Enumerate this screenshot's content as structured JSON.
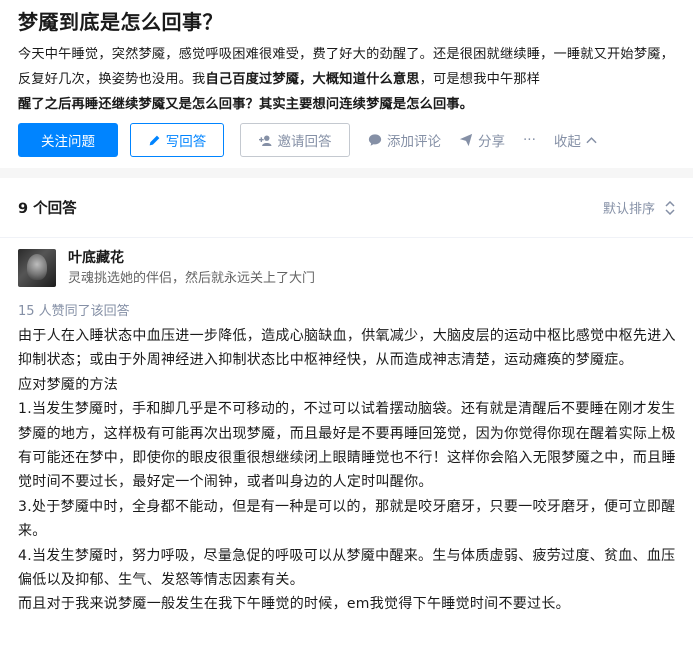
{
  "question": {
    "title": "梦魇到底是怎么回事？",
    "desc_part1": "今天中午睡觉，突然梦魇，感觉呼吸困难很难受，费了好大的劲醒了。还是很困就继续睡，一睡就又开始梦魇，反复好几次，换姿势也没用。我",
    "desc_bold1": "自己百度过梦魇，大概知道什么意思",
    "desc_part2": "，可是想我中午那样",
    "desc_bold2": "醒了之后再睡还继续梦魇又是怎么回事？其实主要想问连续梦魇是怎么回事。"
  },
  "actions": {
    "follow": "关注问题",
    "write": "写回答",
    "invite": "邀请回答",
    "comment": "添加评论",
    "share": "分享",
    "more": "···",
    "collapse": "收起"
  },
  "answers": {
    "count": "9 个回答",
    "sort": "默认排序"
  },
  "answer": {
    "author_name": "叶底藏花",
    "author_bio": "灵魂挑选她的伴侣，然后就永远关上了大门",
    "votes": "15 人赞同了该回答",
    "paragraphs": [
      "由于人在入睡状态中血压进一步降低，造成心脑缺血，供氧减少，大脑皮层的运动中枢比感觉中枢先进入抑制状态；或由于外周神经进入抑制状态比中枢神经快，从而造成神志清楚，运动瘫痪的梦魇症。",
      "应对梦魇的方法",
      "1.当发生梦魇时，手和脚几乎是不可移动的，不过可以试着摆动脑袋。还有就是清醒后不要睡在刚才发生梦魇的地方，这样极有可能再次出现梦魇，而且最好是不要再睡回笼觉，因为你觉得你现在醒着实际上极有可能还在梦中，即使你的眼皮很重很想继续闭上眼睛睡觉也不行！这样你会陷入无限梦魇之中，而且睡觉时间不要过长，最好定一个闹钟，或者叫身边的人定时叫醒你。",
      "3.处于梦魇中时，全身都不能动，但是有一种是可以的，那就是咬牙磨牙，只要一咬牙磨牙，便可立即醒来。",
      "4.当发生梦魇时，努力呼吸，尽量急促的呼吸可以从梦魇中醒来。生与体质虚弱、疲劳过度、贫血、血压偏低以及抑郁、生气、发怒等情志因素有关。",
      "而且对于我来说梦魇一般发生在我下午睡觉的时候，em我觉得下午睡觉时间不要过长。"
    ]
  },
  "colors": {
    "primary": "#0084ff",
    "muted": "#8590a6"
  },
  "icons": [
    "pen-icon",
    "invite-user-icon",
    "comment-icon",
    "share-icon",
    "more-icon",
    "chevron-up-icon",
    "sort-icon"
  ]
}
